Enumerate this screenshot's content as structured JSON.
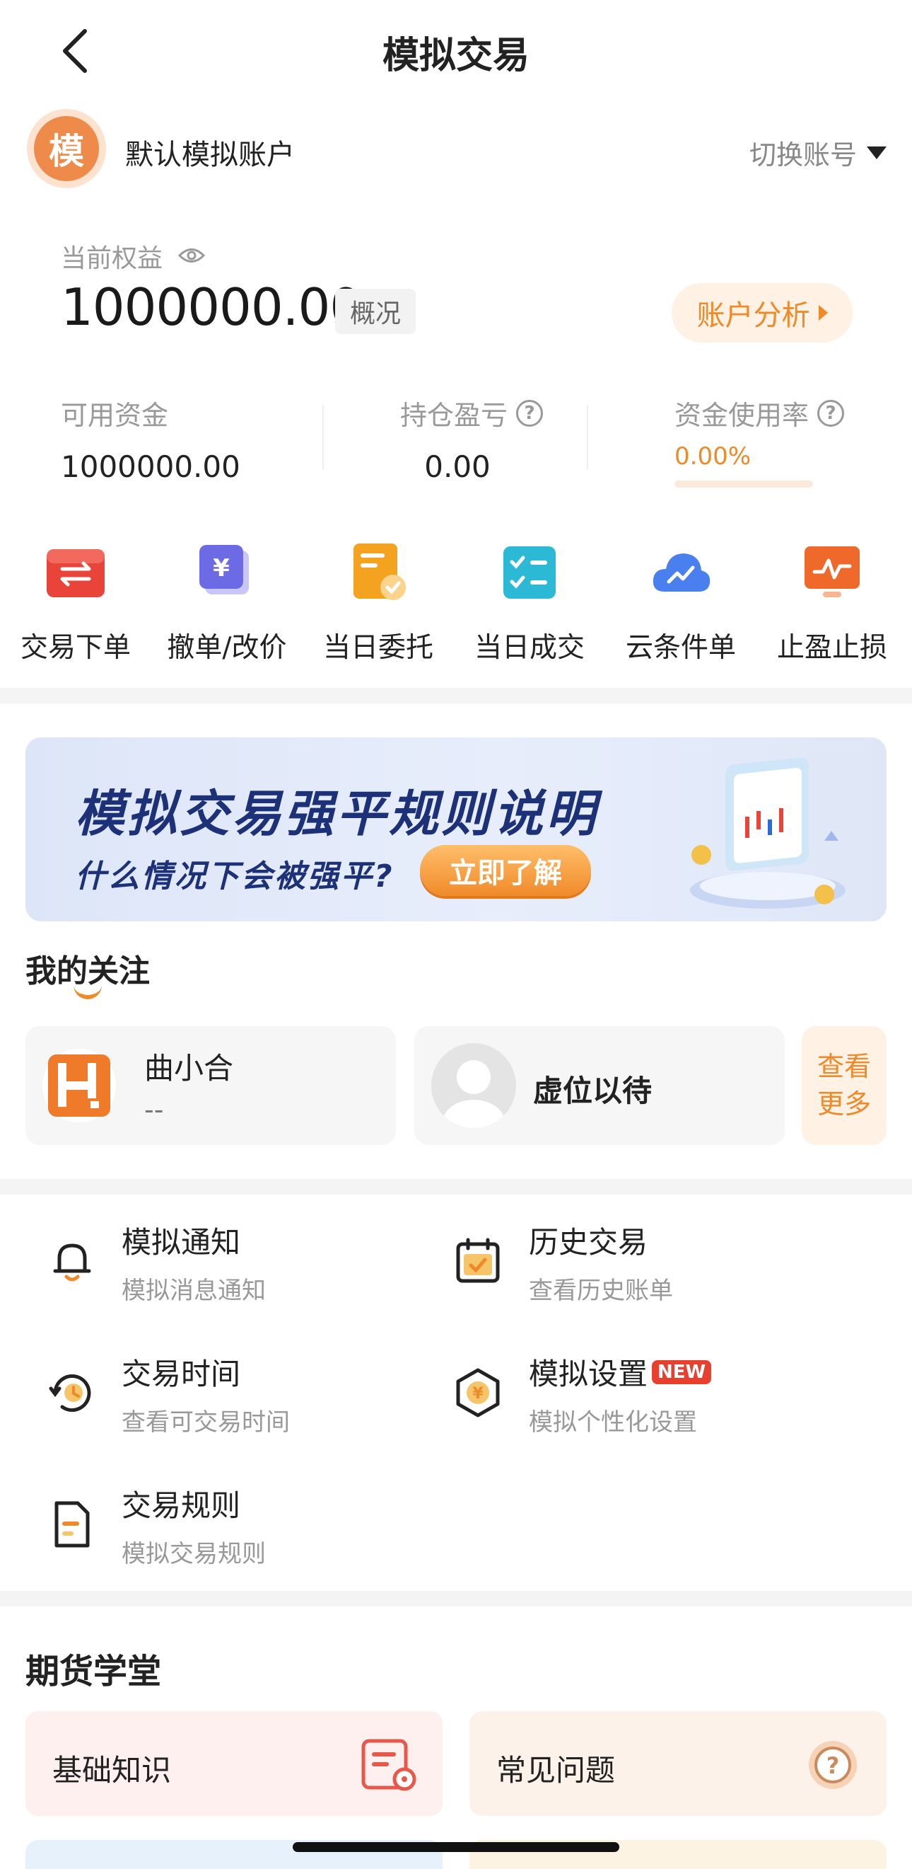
{
  "header": {
    "title": "模拟交易"
  },
  "account": {
    "avatar_char": "模",
    "name": "默认模拟账户",
    "switch_label": "切换账号"
  },
  "equity": {
    "label": "当前权益",
    "value": "1000000.00",
    "tag": "概况",
    "analysis_label": "账户分析"
  },
  "stats": {
    "available": {
      "label": "可用资金",
      "value": "1000000.00"
    },
    "pnl": {
      "label": "持仓盈亏",
      "value": "0.00"
    },
    "usage": {
      "label": "资金使用率",
      "value": "0.00%"
    }
  },
  "quick_actions": [
    {
      "label": "交易下单",
      "icon": "transfer-icon",
      "color": "#e8443a"
    },
    {
      "label": "撤单/改价",
      "icon": "yuan-card-icon",
      "color": "#6d6ae6"
    },
    {
      "label": "当日委托",
      "icon": "doc-check-icon",
      "color": "#f3a320"
    },
    {
      "label": "当日成交",
      "icon": "checklist-icon",
      "color": "#2cb9d6"
    },
    {
      "label": "云条件单",
      "icon": "cloud-icon",
      "color": "#4a7ff0"
    },
    {
      "label": "止盈止损",
      "icon": "chart-board-icon",
      "color": "#ef6a2a"
    }
  ],
  "banner": {
    "title": "模拟交易强平规则说明",
    "subtitle": "什么情况下会被强平?",
    "button": "立即了解"
  },
  "follow": {
    "title": "我的关注",
    "items": [
      {
        "name": "曲小合",
        "value": "--"
      },
      {
        "name": "虚位以待",
        "value": ""
      }
    ],
    "more_label": "查看更多"
  },
  "menu": [
    {
      "title": "模拟通知",
      "subtitle": "模拟消息通知",
      "badge": ""
    },
    {
      "title": "历史交易",
      "subtitle": "查看历史账单",
      "badge": ""
    },
    {
      "title": "交易时间",
      "subtitle": "查看可交易时间",
      "badge": ""
    },
    {
      "title": "模拟设置",
      "subtitle": "模拟个性化设置",
      "badge": "NEW"
    },
    {
      "title": "交易规则",
      "subtitle": "模拟交易规则",
      "badge": ""
    }
  ],
  "school": {
    "title": "期货学堂",
    "cards": [
      {
        "label": "基础知识",
        "icon": "document-icon"
      },
      {
        "label": "常见问题",
        "icon": "question-icon"
      }
    ]
  },
  "colors": {
    "accent": "#ee8a2a",
    "banner_text": "#1c3178",
    "badge_red": "#e8402f"
  }
}
